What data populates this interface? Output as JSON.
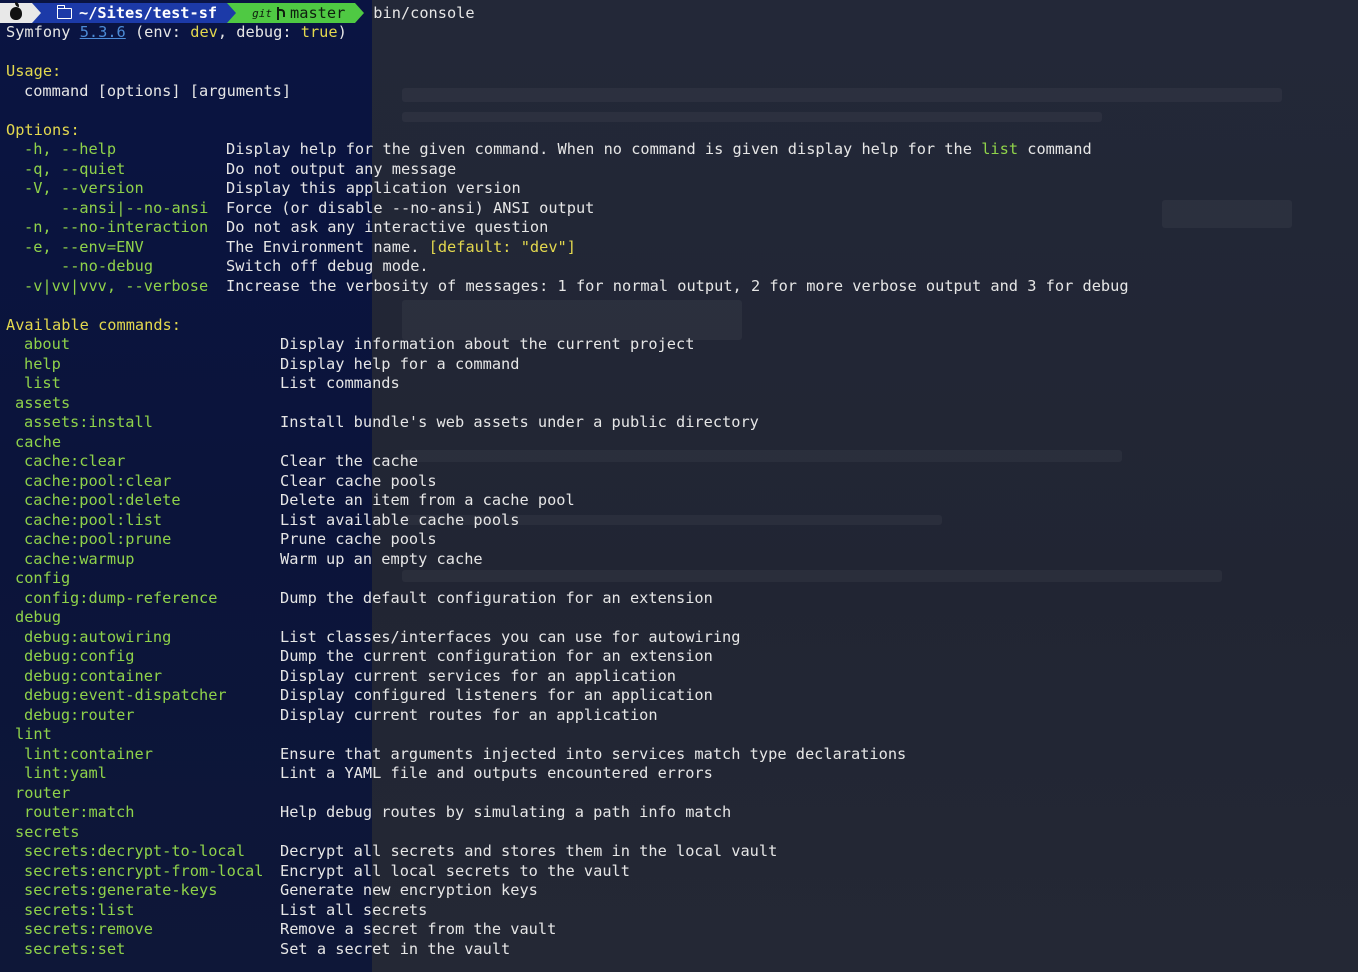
{
  "prompt": {
    "directory": "~/Sites/test-sf",
    "git_label": "git",
    "branch": "master",
    "command": "bin/console"
  },
  "header": {
    "app_name": "Symfony",
    "version": "5.3.6",
    "env_open": "(env: ",
    "env_value": "dev",
    "debug_sep": ", debug: ",
    "debug_value": "true",
    "close": ")"
  },
  "usage": {
    "title": "Usage:",
    "text": "command [options] [arguments]"
  },
  "options": {
    "title": "Options:",
    "items": [
      {
        "flag": "-h, --help",
        "desc": "Display help for the given command. When no command is given display help for the ",
        "desc_highlight": "list",
        "desc_tail": " command"
      },
      {
        "flag": "-q, --quiet",
        "desc": "Do not output any message"
      },
      {
        "flag": "-V, --version",
        "desc": "Display this application version"
      },
      {
        "flag": "--ansi|--no-ansi",
        "desc": "Force (or disable --no-ansi) ANSI output"
      },
      {
        "flag": "-n, --no-interaction",
        "desc": "Do not ask any interactive question"
      },
      {
        "flag": "-e, --env=ENV",
        "desc": "The Environment name. ",
        "desc_default": "[default: \"dev\"]"
      },
      {
        "flag": "--no-debug",
        "desc": "Switch off debug mode."
      },
      {
        "flag": "-v|vv|vvv, --verbose",
        "desc": "Increase the verbosity of messages: 1 for normal output, 2 for more verbose output and 3 for debug"
      }
    ]
  },
  "commands": {
    "title": "Available commands:",
    "top": [
      {
        "name": "about",
        "desc": "Display information about the current project"
      },
      {
        "name": "help",
        "desc": "Display help for a command"
      },
      {
        "name": "list",
        "desc": "List commands"
      }
    ],
    "groups": [
      {
        "name": "assets",
        "items": [
          {
            "name": "assets:install",
            "desc": "Install bundle's web assets under a public directory"
          }
        ]
      },
      {
        "name": "cache",
        "items": [
          {
            "name": "cache:clear",
            "desc": "Clear the cache"
          },
          {
            "name": "cache:pool:clear",
            "desc": "Clear cache pools"
          },
          {
            "name": "cache:pool:delete",
            "desc": "Delete an item from a cache pool"
          },
          {
            "name": "cache:pool:list",
            "desc": "List available cache pools"
          },
          {
            "name": "cache:pool:prune",
            "desc": "Prune cache pools"
          },
          {
            "name": "cache:warmup",
            "desc": "Warm up an empty cache"
          }
        ]
      },
      {
        "name": "config",
        "items": [
          {
            "name": "config:dump-reference",
            "desc": "Dump the default configuration for an extension"
          }
        ]
      },
      {
        "name": "debug",
        "items": [
          {
            "name": "debug:autowiring",
            "desc": "List classes/interfaces you can use for autowiring"
          },
          {
            "name": "debug:config",
            "desc": "Dump the current configuration for an extension"
          },
          {
            "name": "debug:container",
            "desc": "Display current services for an application"
          },
          {
            "name": "debug:event-dispatcher",
            "desc": "Display configured listeners for an application"
          },
          {
            "name": "debug:router",
            "desc": "Display current routes for an application"
          }
        ]
      },
      {
        "name": "lint",
        "items": [
          {
            "name": "lint:container",
            "desc": "Ensure that arguments injected into services match type declarations"
          },
          {
            "name": "lint:yaml",
            "desc": "Lint a YAML file and outputs encountered errors"
          }
        ]
      },
      {
        "name": "router",
        "items": [
          {
            "name": "router:match",
            "desc": "Help debug routes by simulating a path info match"
          }
        ]
      },
      {
        "name": "secrets",
        "items": [
          {
            "name": "secrets:decrypt-to-local",
            "desc": "Decrypt all secrets and stores them in the local vault"
          },
          {
            "name": "secrets:encrypt-from-local",
            "desc": "Encrypt all local secrets to the vault"
          },
          {
            "name": "secrets:generate-keys",
            "desc": "Generate new encryption keys"
          },
          {
            "name": "secrets:list",
            "desc": "List all secrets"
          },
          {
            "name": "secrets:remove",
            "desc": "Remove a secret from the vault"
          },
          {
            "name": "secrets:set",
            "desc": "Set a secret in the vault"
          }
        ]
      }
    ]
  },
  "colors": {
    "heading": "#e3d84e",
    "command": "#8fd24a",
    "text": "#e6e6e6",
    "version_link": "#4c8bd6",
    "prompt_dir_bg": "#1c3aa8",
    "prompt_git_bg": "#4fc943"
  },
  "icons": [
    "apple-icon",
    "folder-icon",
    "git-branch-icon"
  ]
}
